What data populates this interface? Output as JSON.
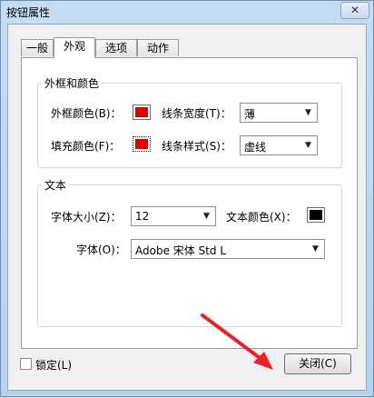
{
  "window": {
    "title": "按钮属性",
    "close_label": "✕"
  },
  "tabs": [
    {
      "label": "一般",
      "active": false
    },
    {
      "label": "外观",
      "active": true
    },
    {
      "label": "选项",
      "active": false
    },
    {
      "label": "动作",
      "active": false
    }
  ],
  "border_color_group": {
    "title": "外框和颜色",
    "border_color_label": "外框颜色(B)：",
    "border_color_value": "#e00000",
    "line_width_label": "线条宽度(T)：",
    "line_width_value": "薄",
    "fill_color_label": "填充颜色(F)：",
    "fill_color_value": "#e00000",
    "line_style_label": "线条样式(S)：",
    "line_style_value": "虚线"
  },
  "text_group": {
    "title": "文本",
    "font_size_label": "字体大小(Z)：",
    "font_size_value": "12",
    "text_color_label": "文本颜色(X)：",
    "text_color_value": "#000000",
    "font_label": "字体(O)：",
    "font_value": "Adobe 宋体 Std L"
  },
  "footer": {
    "lock_label": "锁定(L)",
    "lock_checked": false,
    "close_button_label": "关闭(C)"
  },
  "annotation": {
    "arrow_color": "#e8202a"
  }
}
